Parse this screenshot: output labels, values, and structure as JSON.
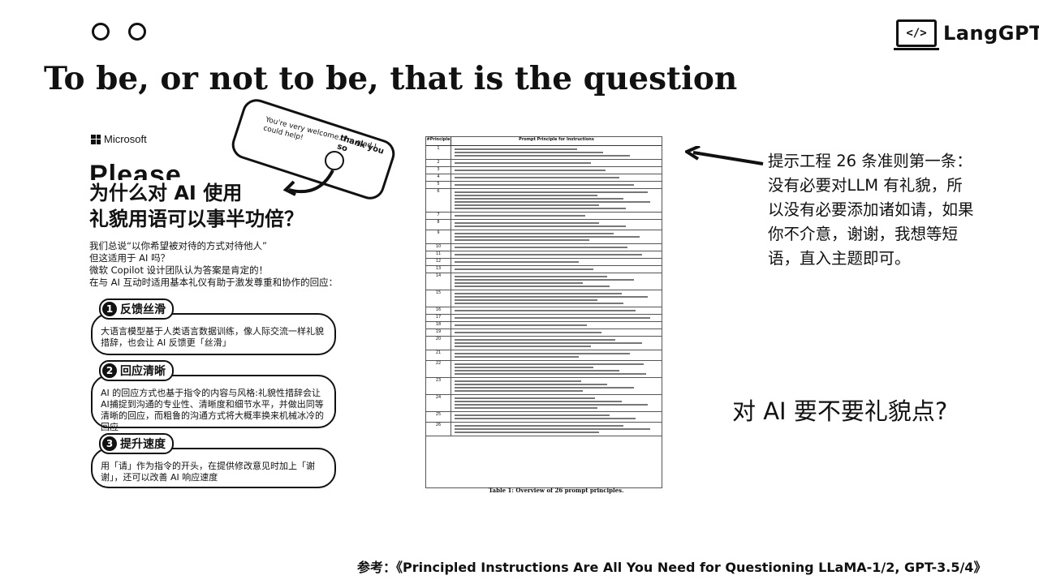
{
  "header": {
    "logo_icon": "</>",
    "logo_text": "LangGPT",
    "title": "To be, or not to be, that is the question"
  },
  "poster": {
    "brand": "Microsoft",
    "card_text": "You're very welcome. I'm glad I could help!",
    "card_corner": "thank you so",
    "please": "Please",
    "headline_line1": "为什么对 AI 使用",
    "headline_line2": "礼貌用语可以事半功倍？",
    "intro": [
      "我们总说“以你希望被对待的方式对待他人”",
      "但这适用于 AI 吗？",
      "微软 Copilot 设计团队认为答案是肯定的！",
      "在与 AI 互动时适用基本礼仪有助于激发尊重和协作的回应："
    ],
    "sections": [
      {
        "num": "1",
        "title": "反馈丝滑",
        "body": "大语言模型基于人类语言数据训练，像人际交流一样礼貌措辞，也会让 AI 反馈更「丝滑」"
      },
      {
        "num": "2",
        "title": "回应清晰",
        "body": "AI 的回应方式也基于指令的内容与风格:礼貌性措辞会让AI捕捉到沟通的专业性、清晰度和细节水平，并做出同等清晰的回应，而粗鲁的沟通方式将大概率换来机械冰冷的回应"
      },
      {
        "num": "3",
        "title": "提升速度",
        "body": "用「请」作为指令的开头，在提供修改意见时加上「谢谢」，还可以改善 AI 响应速度"
      }
    ]
  },
  "table_image": {
    "header_left": "#Principle",
    "header_right": "Prompt Principle for Instructions",
    "rows": [
      "1",
      "2",
      "3",
      "4",
      "5",
      "6",
      "7",
      "8",
      "9",
      "10",
      "11",
      "12",
      "13",
      "14",
      "15",
      "16",
      "17",
      "18",
      "19",
      "20",
      "21",
      "22",
      "23",
      "24",
      "25",
      "26"
    ],
    "caption": "Table 1: Overview of 26 prompt principles."
  },
  "note": {
    "lines": [
      "提示工程 26 条准则第一条：",
      "没有必要对LLM 有礼貌，所",
      "以没有必要添加诸如请，如果",
      "你不介意，谢谢，我想等短",
      "语，直入主题即可。"
    ]
  },
  "question": "对 AI 要不要礼貌点?",
  "reference": "参考：《Principled Instructions Are All You Need for Questioning LLaMA-1/2, GPT-3.5/4》"
}
